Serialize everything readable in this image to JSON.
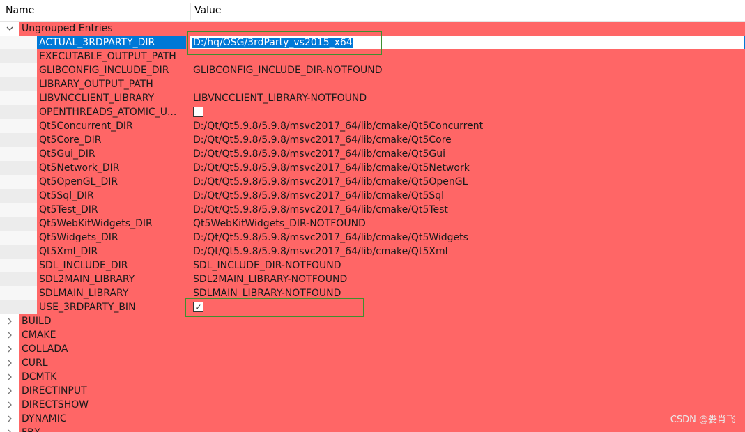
{
  "header": {
    "name_col": "Name",
    "value_col": "Value"
  },
  "group": {
    "label": "Ungrouped Entries"
  },
  "entries": [
    {
      "name": "ACTUAL_3RDPARTY_DIR",
      "value": "D:/hq/OSG/3rdParty_vs2015_x64"
    },
    {
      "name": "EXECUTABLE_OUTPUT_PATH",
      "value": ""
    },
    {
      "name": "GLIBCONFIG_INCLUDE_DIR",
      "value": "GLIBCONFIG_INCLUDE_DIR-NOTFOUND"
    },
    {
      "name": "LIBRARY_OUTPUT_PATH",
      "value": ""
    },
    {
      "name": "LIBVNCCLIENT_LIBRARY",
      "value": "LIBVNCCLIENT_LIBRARY-NOTFOUND"
    },
    {
      "name": "OPENTHREADS_ATOMIC_U...",
      "value": ""
    },
    {
      "name": "Qt5Concurrent_DIR",
      "value": "D:/Qt/Qt5.9.8/5.9.8/msvc2017_64/lib/cmake/Qt5Concurrent"
    },
    {
      "name": "Qt5Core_DIR",
      "value": "D:/Qt/Qt5.9.8/5.9.8/msvc2017_64/lib/cmake/Qt5Core"
    },
    {
      "name": "Qt5Gui_DIR",
      "value": "D:/Qt/Qt5.9.8/5.9.8/msvc2017_64/lib/cmake/Qt5Gui"
    },
    {
      "name": "Qt5Network_DIR",
      "value": "D:/Qt/Qt5.9.8/5.9.8/msvc2017_64/lib/cmake/Qt5Network"
    },
    {
      "name": "Qt5OpenGL_DIR",
      "value": "D:/Qt/Qt5.9.8/5.9.8/msvc2017_64/lib/cmake/Qt5OpenGL"
    },
    {
      "name": "Qt5Sql_DIR",
      "value": "D:/Qt/Qt5.9.8/5.9.8/msvc2017_64/lib/cmake/Qt5Sql"
    },
    {
      "name": "Qt5Test_DIR",
      "value": "D:/Qt/Qt5.9.8/5.9.8/msvc2017_64/lib/cmake/Qt5Test"
    },
    {
      "name": "Qt5WebKitWidgets_DIR",
      "value": "Qt5WebKitWidgets_DIR-NOTFOUND"
    },
    {
      "name": "Qt5Widgets_DIR",
      "value": "D:/Qt/Qt5.9.8/5.9.8/msvc2017_64/lib/cmake/Qt5Widgets"
    },
    {
      "name": "Qt5Xml_DIR",
      "value": "D:/Qt/Qt5.9.8/5.9.8/msvc2017_64/lib/cmake/Qt5Xml"
    },
    {
      "name": "SDL_INCLUDE_DIR",
      "value": "SDL_INCLUDE_DIR-NOTFOUND"
    },
    {
      "name": "SDL2MAIN_LIBRARY",
      "value": "SDL2MAIN_LIBRARY-NOTFOUND"
    },
    {
      "name": "SDLMAIN_LIBRARY",
      "value": "SDLMAIN_LIBRARY-NOTFOUND"
    },
    {
      "name": "USE_3RDPARTY_BIN",
      "value": ""
    }
  ],
  "checkbox_states": {
    "openthreads_atomic": false,
    "use_3rdparty_bin": true,
    "check_mark": "✓"
  },
  "groups": [
    "BUILD",
    "CMAKE",
    "COLLADA",
    "CURL",
    "DCMTK",
    "DIRECTINPUT",
    "DIRECTSHOW",
    "DYNAMIC",
    "FBX"
  ],
  "watermark": "CSDN @娄肖飞",
  "colors": {
    "entry_bg": "#ff6666",
    "selection": "#0078d7",
    "highlight_box": "#3f8f2f"
  }
}
